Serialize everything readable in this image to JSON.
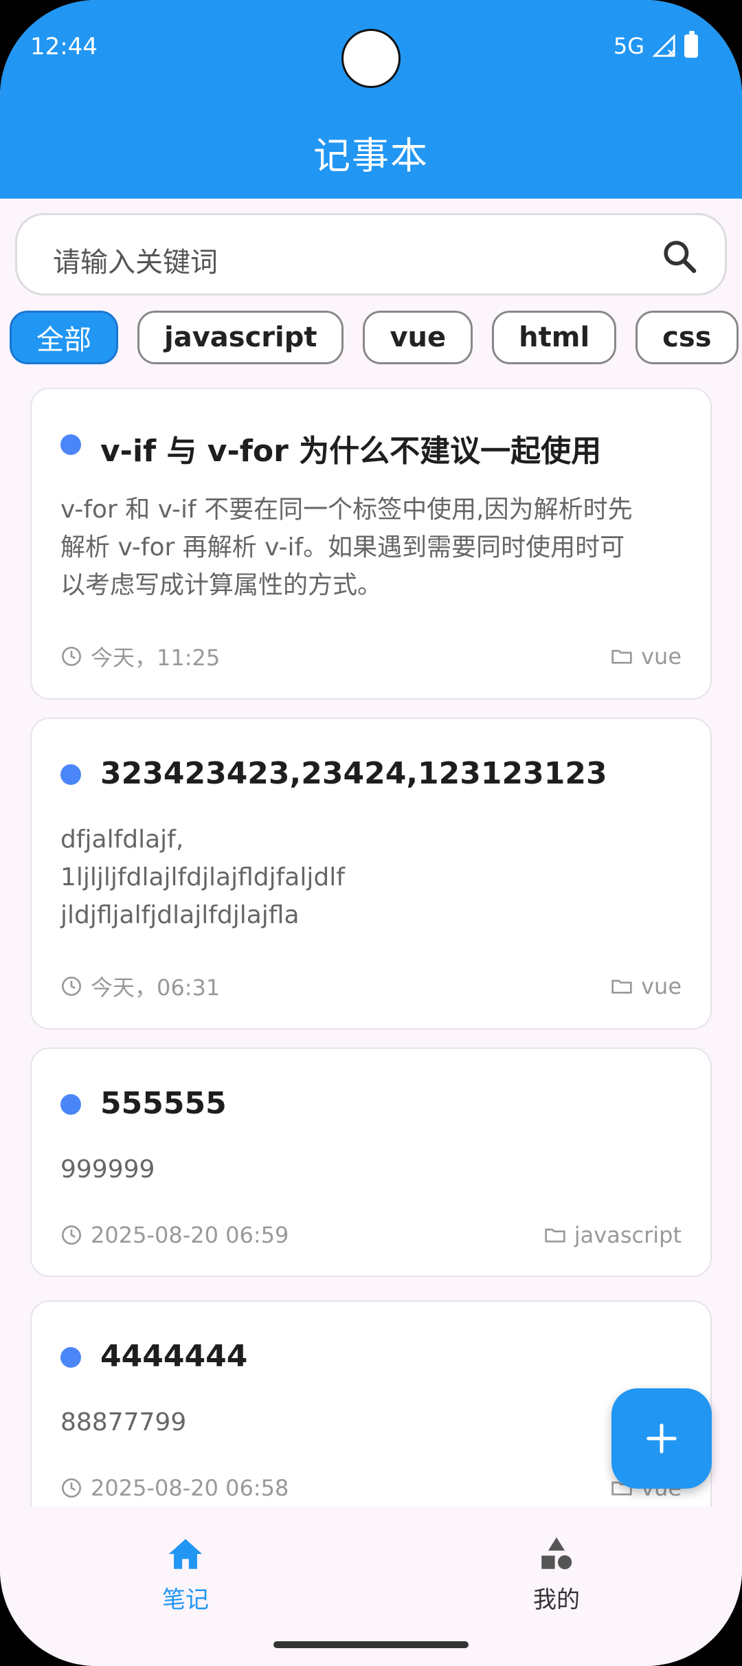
{
  "status_bar": {
    "time": "12:44",
    "network": "5G"
  },
  "header": {
    "title": "记事本"
  },
  "search": {
    "placeholder": "请输入关键词"
  },
  "categories": [
    "全部",
    "javascript",
    "vue",
    "html",
    "css"
  ],
  "notes": [
    {
      "title": "v-if 与 v-for 为什么不建议一起使用",
      "content": [
        "v-for 和 v-if 不要在同一个标签中使用,因为解析时先",
        "解析 v-for 再解析 v-if。如果遇到需要同时使用时可",
        "以考虑写成计算属性的方式。"
      ],
      "time": "今天，11:25",
      "category": "vue"
    },
    {
      "title": "323423423,23424,123123123",
      "content": [
        "dfjalfdlajf,",
        "1ljljljfdlajlfdjlajfldjfaljdlf",
        "jldjfljalfjdlajlfdjlajfla"
      ],
      "time": "今天，06:31",
      "category": "vue"
    },
    {
      "title": "555555",
      "content": [
        "999999"
      ],
      "time": "2025-08-20 06:59",
      "category": "javascript"
    },
    {
      "title": "4444444",
      "content": [
        "88877799"
      ],
      "time": "2025-08-20 06:58",
      "category": "vue"
    }
  ],
  "bottom_nav": {
    "notes_label": "笔记",
    "mine_label": "我的"
  },
  "colors": {
    "primary": "#2196f3",
    "dot": "#4a86f7",
    "background": "#fcf5fc"
  }
}
